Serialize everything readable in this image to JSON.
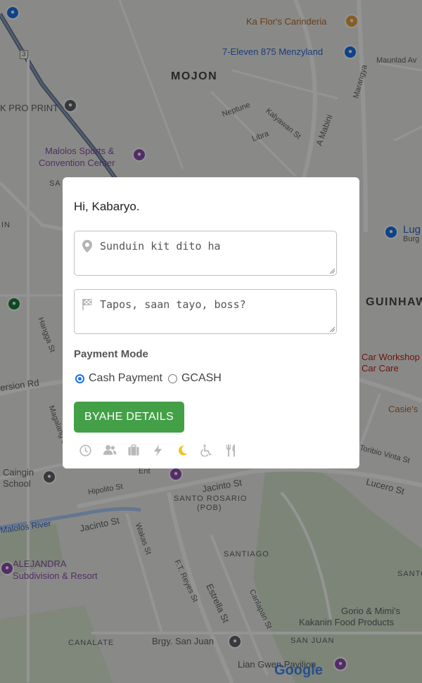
{
  "modal": {
    "greeting": "Hi, Kabaryo.",
    "pickup_placeholder": "Sunduin kit dito ha",
    "dropoff_placeholder": "Tapos, saan tayo, boss?",
    "payment_title": "Payment Mode",
    "payment_options": [
      {
        "label": "Cash Payment",
        "selected": true
      },
      {
        "label": "GCASH",
        "selected": false
      }
    ],
    "submit_label": "BYAHE DETAILS",
    "option_icons": [
      {
        "icon": "clock-icon",
        "active": false
      },
      {
        "icon": "users-icon",
        "active": false
      },
      {
        "icon": "luggage-icon",
        "active": false
      },
      {
        "icon": "bolt-icon",
        "active": false
      },
      {
        "icon": "moon-icon",
        "active": true
      },
      {
        "icon": "wheelchair-icon",
        "active": false
      },
      {
        "icon": "utensils-icon",
        "active": false
      }
    ],
    "colors": {
      "button": "#43a047",
      "icon_inactive": "#b8b8b8",
      "icon_active": "#f2c418",
      "radio_selected": "#1a73e8"
    }
  },
  "map": {
    "labels": {
      "mojon": "MOJON",
      "guinhawa": "GUINHAW",
      "santo_rosario": "SANTO ROSARIO",
      "pob": "(POB)",
      "santiago": "SANTIAGO",
      "santo": "SANTO",
      "canalate": "CANALATE",
      "san_juan": "SAN JUAN",
      "ka_flors": "Ka Flor's Carinderia",
      "seven_eleven": "7-Eleven 875 Menzyland",
      "maunlad": "Maunlad Av",
      "pro_print": "K PRO PRINT",
      "malolos_sports": "Malolos Sports &",
      "convention": "Convention Center",
      "neptune": "Neptune",
      "kalyawan": "Kalyawan St",
      "libra": "Libra",
      "a_mabini": "A Mabini",
      "marangya": "Marangya",
      "lug": "Lug",
      "burg": "Burg",
      "car_workshop": "Car Workshop",
      "car_care": "Car Care",
      "casies": "Casie's",
      "caingin": "Caingin",
      "school": "School",
      "hipolito": "Hipolito St",
      "jacinto1": "Jacinto St",
      "jacinto2": "Jacinto St",
      "malolos_river": "Malolos River",
      "alejandra": "ALEJANDRA",
      "subdivision": "Subdivision & Resort",
      "ft_reyes": "F.T. Reyes St",
      "estrella": "Estrella St",
      "canlapan": "Canlapan St",
      "gorio": "Gorio & Mimi's",
      "kakanin": "Kakanin Food Products",
      "brgy_san_juan": "Brgy. San Juan",
      "lian_gwen": "Lian Gwen Pavilion",
      "toribio": "Toribio Vinta St",
      "lucero": "Lucero St",
      "version_rd": "ersion Rd",
      "hangga": "Hangga St",
      "magalang": "Magalang St",
      "sa": "SA",
      "in": "IN",
      "wakas": "Wakas St",
      "ent": "Ent",
      "google": "Google",
      "road_3": "3"
    }
  }
}
